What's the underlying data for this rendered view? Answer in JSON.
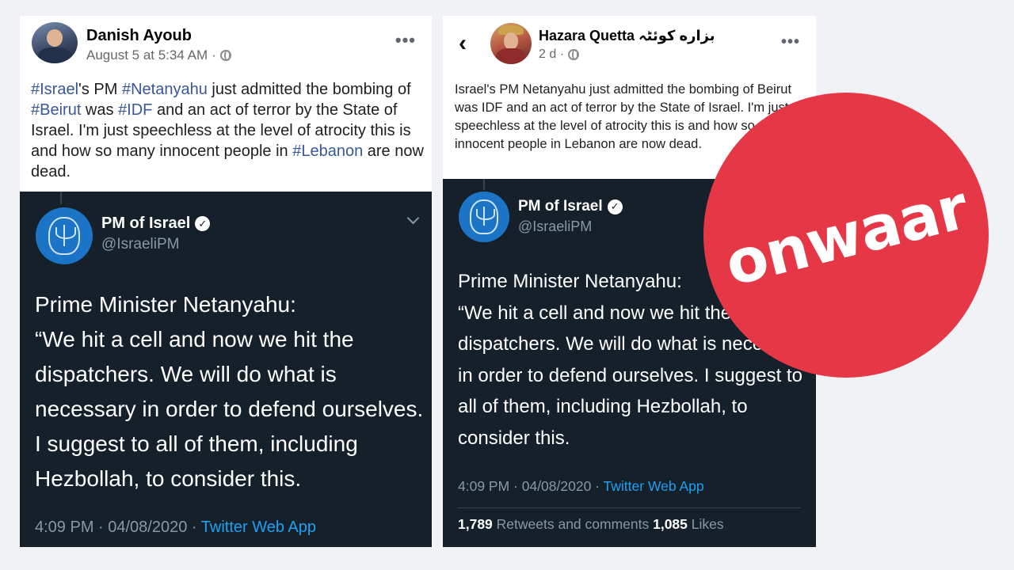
{
  "left_post": {
    "author": "Danish Ayoub",
    "timestamp": "August 5 at 5:34 AM",
    "text_parts": [
      {
        "text": "#Israel",
        "hashtag": true
      },
      {
        "text": "'s PM ",
        "hashtag": false
      },
      {
        "text": "#Netanyahu",
        "hashtag": true
      },
      {
        "text": " just admitted the bombing of ",
        "hashtag": false
      },
      {
        "text": "#Beirut",
        "hashtag": true
      },
      {
        "text": " was ",
        "hashtag": false
      },
      {
        "text": "#IDF",
        "hashtag": true
      },
      {
        "text": " and an act of terror by the State of Israel. I'm just speechless at the level of atrocity this is and how so many innocent people in ",
        "hashtag": false
      },
      {
        "text": "#Lebanon",
        "hashtag": true
      },
      {
        "text": " are now dead.",
        "hashtag": false
      }
    ],
    "tweet": {
      "name": "PM of Israel",
      "handle": "@IsraeliPM",
      "text": "Prime Minister Netanyahu:\n “We hit a cell and now we hit the dispatchers. We will do what is necessary in order to defend ourselves. I suggest to all of them, including Hezbollah, to consider this.",
      "time": "4:09 PM · 04/08/2020 · ",
      "source": "Twitter Web App"
    }
  },
  "right_post": {
    "author": "Hazara Quetta بزاره کوئٹہ",
    "timestamp": "2 d ·",
    "text": "Israel's PM Netanyahu just admitted the bombing of Beirut was IDF and an act of terror by the State of Israel. I'm just speechless at the level of atrocity this is and how so many innocent people in Lebanon are now dead.",
    "tweet": {
      "name": "PM of Israel",
      "handle": "@IsraeliPM",
      "text": "Prime Minister Netanyahu:\n “We hit a cell and now we hit the dispatchers. We will do what is necessary in order to defend ourselves. I suggest to all of them, including Hezbollah, to consider this.",
      "time": "4:09 PM · 04/08/2020 · ",
      "source": "Twitter Web App",
      "retweets_count": "1,789",
      "retweets_label": " Retweets and comments ",
      "likes_count": "1,085",
      "likes_label": " Likes"
    }
  },
  "badge": {
    "text": "onwaar",
    "color": "#e63746"
  },
  "icons": {
    "more": "more-options-icon",
    "back": "back-arrow-icon",
    "globe": "globe-icon",
    "verified": "verified-badge-icon",
    "chevron": "chevron-down-icon"
  },
  "colors": {
    "hashtag": "#385898",
    "twitter_bg": "#15202b",
    "twitter_link": "#1da1f2"
  }
}
